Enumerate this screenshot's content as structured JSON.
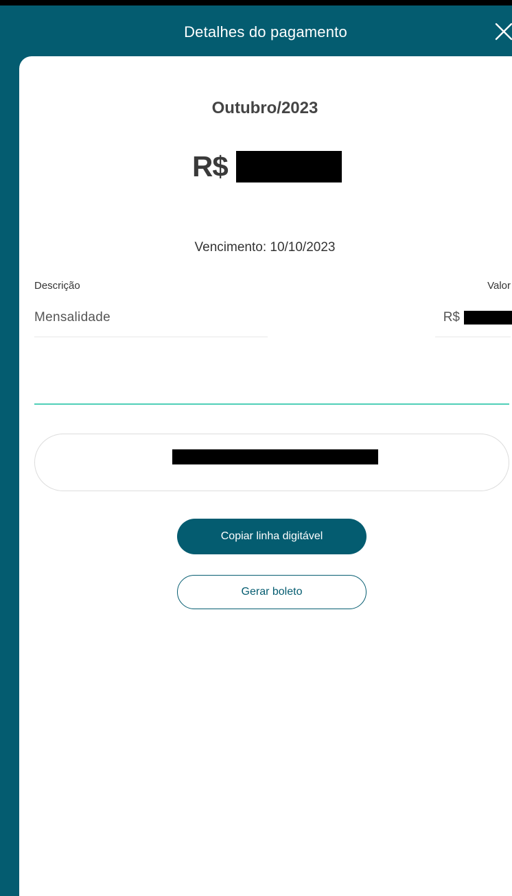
{
  "header": {
    "title": "Detalhes do pagamento",
    "close_icon": "close-icon"
  },
  "summary": {
    "month": "Outubro/2023",
    "currency": "R$",
    "due_label": "Vencimento: 10/10/2023"
  },
  "table": {
    "columns": [
      "Descrição",
      "Valor"
    ],
    "rows": [
      {
        "description": "Mensalidade",
        "currency": "R$"
      }
    ]
  },
  "actions": {
    "copy_label": "Copiar linha digitável",
    "boleto_label": "Gerar boleto"
  },
  "colors": {
    "brand": "#045c70",
    "accent": "#4fcfb8",
    "background": "#ffffff"
  }
}
